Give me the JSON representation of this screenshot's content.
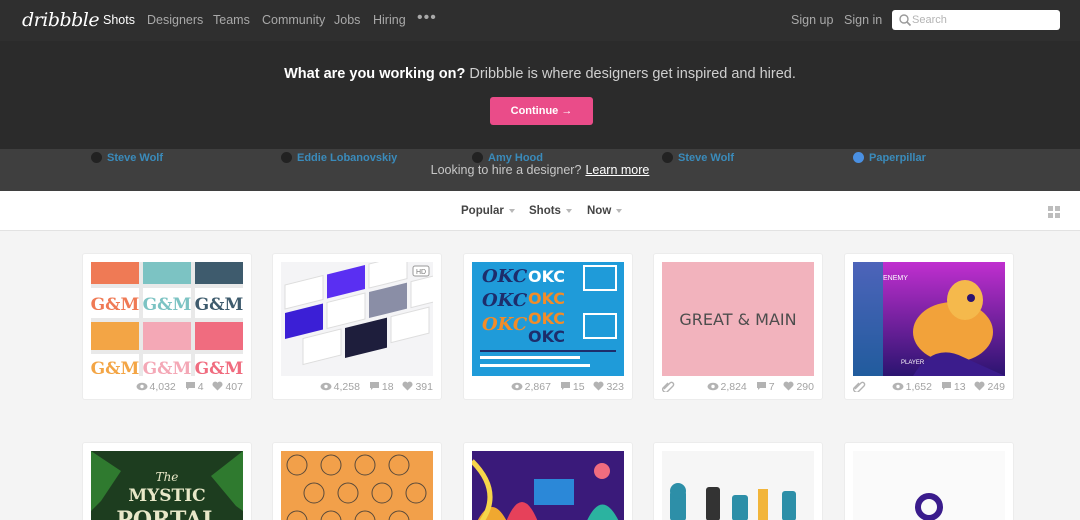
{
  "nav": {
    "logo": "dribbble",
    "items": [
      "Shots",
      "Designers",
      "Teams",
      "Community",
      "Jobs",
      "Hiring"
    ],
    "more": "•••",
    "signup": "Sign up",
    "signin": "Sign in",
    "search_placeholder": "Search"
  },
  "hero": {
    "bold": "What are you working on?",
    "text": " Dribbble is where designers get inspired and hired.",
    "button": "Continue →"
  },
  "hire": {
    "text": "Looking to hire a designer?",
    "link": "Learn more"
  },
  "filters": [
    "Popular",
    "Shots",
    "Now"
  ],
  "shots": [
    {
      "views": "4,032",
      "comments": "4",
      "likes": "407",
      "author": "Steve Wolf",
      "attachment": false
    },
    {
      "views": "4,258",
      "comments": "18",
      "likes": "391",
      "author": "Eddie Lobanovskiy",
      "attachment": false
    },
    {
      "views": "2,867",
      "comments": "15",
      "likes": "323",
      "author": "Amy Hood",
      "attachment": false
    },
    {
      "views": "2,824",
      "comments": "7",
      "likes": "290",
      "author": "Steve Wolf",
      "attachment": true
    },
    {
      "views": "1,652",
      "comments": "13",
      "likes": "249",
      "author": "Paperpillar",
      "attachment": true
    }
  ],
  "thumb_text": {
    "gm": "G&M",
    "okc": "OKC",
    "great_main": "GREAT & MAIN",
    "player": "PLAYER",
    "enemy": "ENEMY",
    "mystic_the": "The",
    "mystic": "MYSTIC",
    "portal": "PORTAL",
    "hd_badge": "HD"
  },
  "colors": {
    "accent": "#ea4c89",
    "link": "#3a8bbb",
    "nav_bg": "#2f2f2f"
  }
}
